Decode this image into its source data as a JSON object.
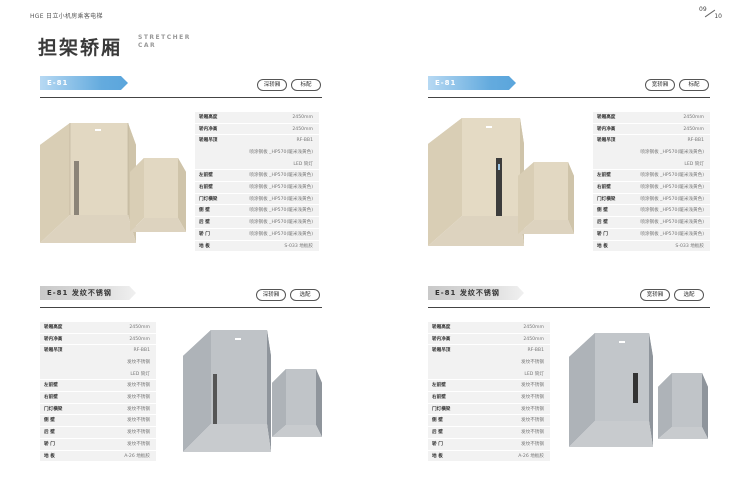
{
  "header": {
    "brand": "HGE 日立小机房乘客电梯",
    "page_current": "09",
    "page_total": "10"
  },
  "title": {
    "main": "担架轿厢",
    "sub_line1": "STRETCHER",
    "sub_line2": "CAR"
  },
  "panels": {
    "tl": {
      "tag": "E-81",
      "buttons": [
        "深轿厢",
        "标配"
      ],
      "specs": [
        {
          "k": "轿厢高度",
          "v": "2450mm"
        },
        {
          "k": "轿内净高",
          "v": "2450mm"
        },
        {
          "k": "轿厢吊顶",
          "v1": "RF-BB1",
          "v2": "喷涂钢板 _HP570(暖米浅黄色)",
          "v3": "LED 筒灯"
        },
        {
          "k": "左前壁",
          "v": "喷涂钢板 _HP570(暖米浅黄色)"
        },
        {
          "k": "右前壁",
          "v": "喷涂钢板 _HP570(暖米浅黄色)"
        },
        {
          "k": "门灯横梁",
          "v": "喷涂钢板 _HP570(暖米浅黄色)"
        },
        {
          "k": "侧 壁",
          "v": "喷涂钢板 _HP570(暖米浅黄色)"
        },
        {
          "k": "后 壁",
          "v": "喷涂钢板 _HP570(暖米浅黄色)"
        },
        {
          "k": "轿 门",
          "v": "喷涂钢板 _HP570(暖米浅黄色)"
        },
        {
          "k": "地 板",
          "v": "S-033 地板胶"
        }
      ]
    },
    "tr": {
      "tag": "E-81",
      "buttons": [
        "宽轿厢",
        "标配"
      ],
      "specs": [
        {
          "k": "轿厢高度",
          "v": "2450mm"
        },
        {
          "k": "轿内净高",
          "v": "2450mm"
        },
        {
          "k": "轿厢吊顶",
          "v1": "RF-BB1",
          "v2": "喷涂钢板 _HP570(暖米浅黄色)",
          "v3": "LED 筒灯"
        },
        {
          "k": "左前壁",
          "v": "喷涂钢板 _HP570(暖米浅黄色)"
        },
        {
          "k": "右前壁",
          "v": "喷涂钢板 _HP570(暖米浅黄色)"
        },
        {
          "k": "门灯横梁",
          "v": "喷涂钢板 _HP570(暖米浅黄色)"
        },
        {
          "k": "侧 壁",
          "v": "喷涂钢板 _HP570(暖米浅黄色)"
        },
        {
          "k": "后 壁",
          "v": "喷涂钢板 _HP570(暖米浅黄色)"
        },
        {
          "k": "轿 门",
          "v": "喷涂钢板 _HP570(暖米浅黄色)"
        },
        {
          "k": "地 板",
          "v": "S-033 地板胶"
        }
      ]
    },
    "bl": {
      "tag": "E-81  发纹不锈钢",
      "buttons": [
        "深轿厢",
        "选配"
      ],
      "specs": [
        {
          "k": "轿厢高度",
          "v": "2450mm"
        },
        {
          "k": "轿内净高",
          "v": "2450mm"
        },
        {
          "k": "轿厢吊顶",
          "v1": "RF-BB1",
          "v2": "发纹不锈钢",
          "v3": "LED 筒灯"
        },
        {
          "k": "左前壁",
          "v": "发纹不锈钢"
        },
        {
          "k": "右前壁",
          "v": "发纹不锈钢"
        },
        {
          "k": "门灯横梁",
          "v": "发纹不锈钢"
        },
        {
          "k": "侧 壁",
          "v": "发纹不锈钢"
        },
        {
          "k": "后 壁",
          "v": "发纹不锈钢"
        },
        {
          "k": "轿 门",
          "v": "发纹不锈钢"
        },
        {
          "k": "地 板",
          "v": "A-26 地板胶"
        }
      ]
    },
    "br": {
      "tag": "E-81  发纹不锈钢",
      "buttons": [
        "宽轿厢",
        "选配"
      ],
      "specs": [
        {
          "k": "轿厢高度",
          "v": "2450mm"
        },
        {
          "k": "轿内净高",
          "v": "2450mm"
        },
        {
          "k": "轿厢吊顶",
          "v1": "RF-BB1",
          "v2": "发纹不锈钢",
          "v3": "LED 筒灯"
        },
        {
          "k": "左前壁",
          "v": "发纹不锈钢"
        },
        {
          "k": "右前壁",
          "v": "发纹不锈钢"
        },
        {
          "k": "门灯横梁",
          "v": "发纹不锈钢"
        },
        {
          "k": "侧 壁",
          "v": "发纹不锈钢"
        },
        {
          "k": "后 壁",
          "v": "发纹不锈钢"
        },
        {
          "k": "轿 门",
          "v": "发纹不锈钢"
        },
        {
          "k": "地 板",
          "v": "A-26 地板胶"
        }
      ]
    }
  },
  "colors": {
    "accent_blue": "#5aa5dc",
    "beige_wall": "#d8cdb4",
    "steel_wall": "#9aa0a6",
    "rule": "#444444"
  }
}
